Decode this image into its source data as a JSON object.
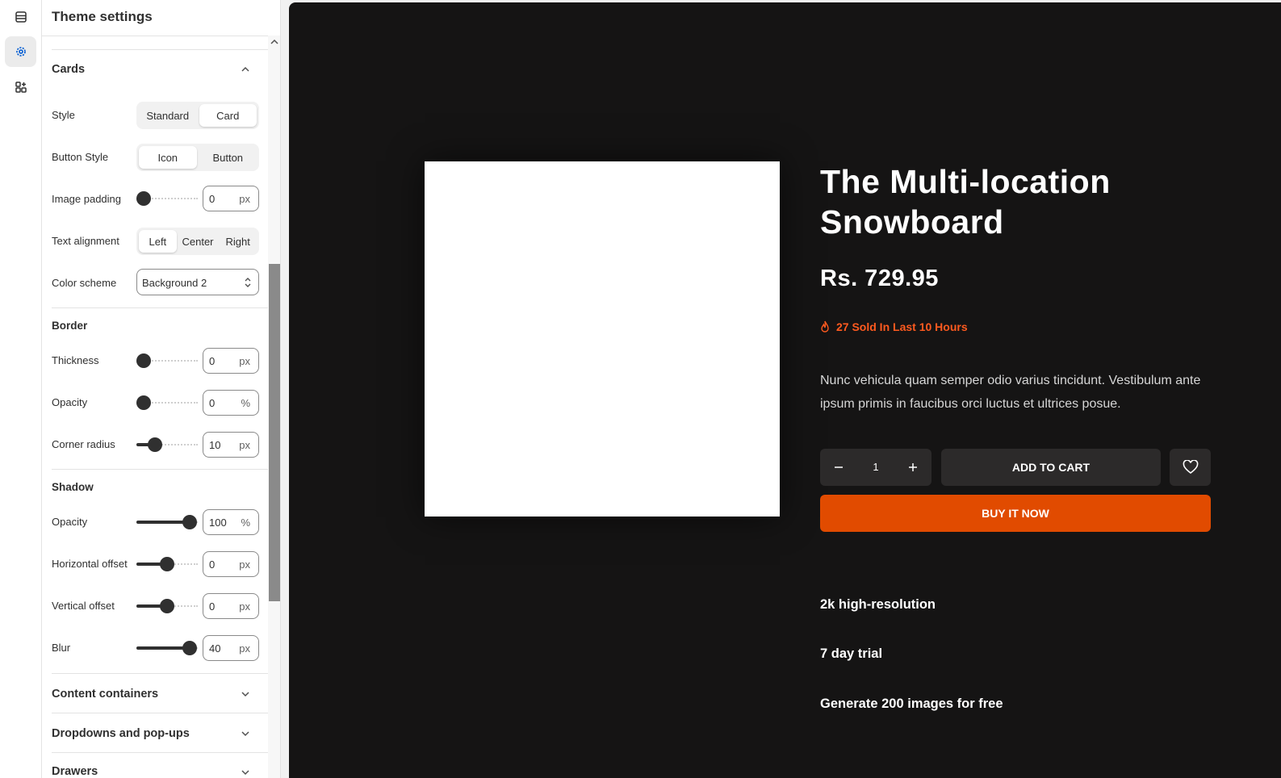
{
  "panel": {
    "title": "Theme settings"
  },
  "cards": {
    "title": "Cards",
    "style": {
      "label": "Style",
      "options": [
        "Standard",
        "Card"
      ],
      "selected": "Card"
    },
    "button_style": {
      "label": "Button Style",
      "options": [
        "Icon",
        "Button"
      ],
      "selected": "Icon"
    },
    "image_padding": {
      "label": "Image padding",
      "value": "0",
      "unit": "px"
    },
    "text_alignment": {
      "label": "Text alignment",
      "options": [
        "Left",
        "Center",
        "Right"
      ],
      "selected": "Left"
    },
    "color_scheme": {
      "label": "Color scheme",
      "value": "Background 2"
    }
  },
  "border": {
    "title": "Border",
    "thickness": {
      "label": "Thickness",
      "value": "0",
      "unit": "px"
    },
    "opacity": {
      "label": "Opacity",
      "value": "0",
      "unit": "%"
    },
    "corner_radius": {
      "label": "Corner radius",
      "value": "10",
      "unit": "px"
    }
  },
  "shadow": {
    "title": "Shadow",
    "opacity": {
      "label": "Opacity",
      "value": "100",
      "unit": "%"
    },
    "horizontal_offset": {
      "label": "Horizontal offset",
      "value": "0",
      "unit": "px"
    },
    "vertical_offset": {
      "label": "Vertical offset",
      "value": "0",
      "unit": "px"
    },
    "blur": {
      "label": "Blur",
      "value": "40",
      "unit": "px"
    }
  },
  "collapsed_sections": [
    "Content containers",
    "Dropdowns and pop-ups",
    "Drawers"
  ],
  "product": {
    "title": "The Multi-location Snowboard",
    "price": "Rs. 729.95",
    "sold_text": "27 Sold In Last 10 Hours",
    "description": "Nunc vehicula quam semper odio varius tincidunt. Vestibulum ante ipsum primis in faucibus orci luctus et ultrices posue.",
    "quantity": "1",
    "add_to_cart": "ADD TO CART",
    "buy_now": "BUY IT NOW",
    "features": [
      "2k high-resolution",
      "7 day trial",
      "Generate 200 images for free"
    ]
  },
  "icons": {
    "rail": [
      "sections-icon",
      "settings-gear-icon",
      "apps-icon"
    ],
    "sold": "flame-icon",
    "wishlist": "heart-icon"
  },
  "colors": {
    "accent": "#e14b00",
    "sold_text": "#ff5a1f",
    "preview_bg": "#151414",
    "button_bg": "#2c2a2a"
  }
}
